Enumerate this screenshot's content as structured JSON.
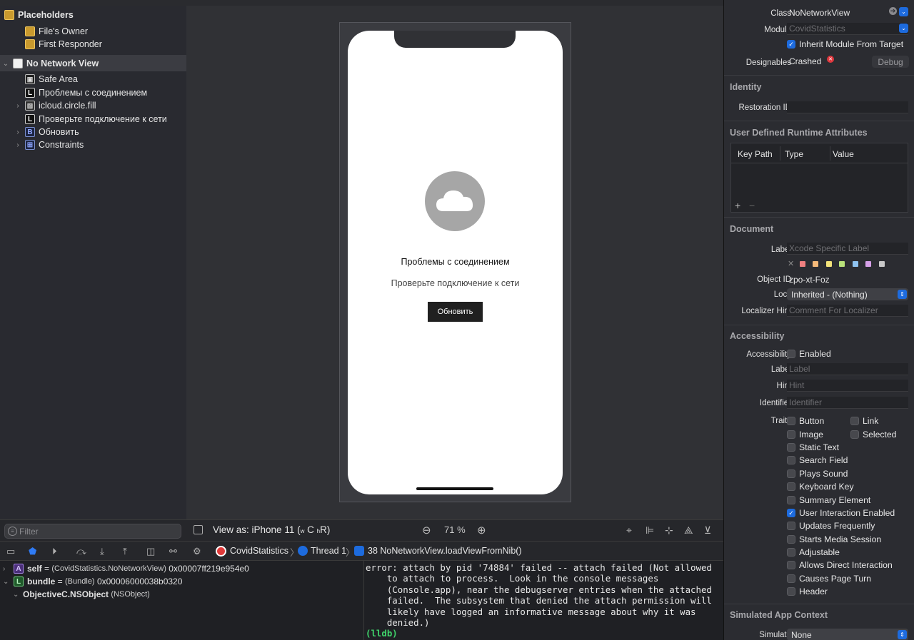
{
  "outline": {
    "items": [
      {
        "label": "Placeholders",
        "bold": true
      },
      {
        "label": "File's Owner"
      },
      {
        "label": "First Responder"
      },
      {
        "label": "No Network View",
        "bold": true
      },
      {
        "label": "Safe Area"
      },
      {
        "label": "Проблемы с соединением"
      },
      {
        "label": "icloud.circle.fill"
      },
      {
        "label": "Проверьте подключение к сети"
      },
      {
        "label": "Обновить"
      },
      {
        "label": "Constraints"
      }
    ],
    "filter_placeholder": "Filter"
  },
  "canvas": {
    "title": "Проблемы с соединением",
    "subtitle": "Проверьте подключение к сети",
    "button": "Обновить",
    "view_as": "View as: iPhone 11 (",
    "view_as_w": "w",
    "view_as_c": "C",
    "view_as_h": "h",
    "view_as_r": "R)",
    "zoom": "71 %"
  },
  "debug": {
    "target": "CovidStatistics",
    "thread": "Thread 1",
    "frame": "38 NoNetworkView.loadViewFromNib()"
  },
  "vars": [
    {
      "badge": "A",
      "name": "self",
      "type": "(CovidStatistics.NoNetworkView)",
      "value": "0x00007ff219e954e0"
    },
    {
      "badge": "L",
      "name": "bundle",
      "type": "(Bundle)",
      "value": "0x00006000038b0320"
    },
    {
      "name": "ObjectiveC.NSObject",
      "type": "(NSObject)"
    }
  ],
  "console": {
    "lines": [
      "error: attach by pid '74884' failed -- attach failed (Not allowed",
      "    to attach to process.  Look in the console messages",
      "    (Console.app), near the debugserver entries when the attached",
      "    failed.  The subsystem that denied the attach permission will",
      "    likely have logged an informative message about why it was",
      "    denied.)"
    ],
    "prompt": "(lldb)"
  },
  "inspector": {
    "class_label": "Class",
    "class_value": "NoNetworkView",
    "module_label": "Module",
    "module_value": "CovidStatistics",
    "inherit": "Inherit Module From Target",
    "designables_label": "Designables",
    "designables_value": "Crashed",
    "debug_btn": "Debug",
    "identity": "Identity",
    "restoration_label": "Restoration ID",
    "udra": "User Defined Runtime Attributes",
    "col_key": "Key Path",
    "col_type": "Type",
    "col_value": "Value",
    "document": "Document",
    "doc_label": "Label",
    "doc_label_ph": "Xcode Specific Label",
    "object_id_label": "Object ID",
    "object_id": "zpo-xt-Foz",
    "lock_label": "Lock",
    "lock_value": "Inherited - (Nothing)",
    "loc_hint_label": "Localizer Hint",
    "loc_hint_ph": "Comment For Localizer",
    "accessibility": "Accessibility",
    "acc_label": "Accessibility",
    "acc_enabled": "Enabled",
    "label_label": "Label",
    "label_ph": "Label",
    "hint_label": "Hint",
    "hint_ph": "Hint",
    "ident_label": "Identifier",
    "ident_ph": "Identifier",
    "traits_label": "Traits",
    "traits": [
      {
        "label": "Button",
        "on": false
      },
      {
        "label": "Link",
        "on": false
      },
      {
        "label": "Image",
        "on": false
      },
      {
        "label": "Selected",
        "on": false
      },
      {
        "label": "Static Text",
        "on": false
      },
      {
        "label": "Search Field",
        "on": false
      },
      {
        "label": "Plays Sound",
        "on": false
      },
      {
        "label": "Keyboard Key",
        "on": false
      },
      {
        "label": "Summary Element",
        "on": false
      },
      {
        "label": "User Interaction Enabled",
        "on": true
      },
      {
        "label": "Updates Frequently",
        "on": false
      },
      {
        "label": "Starts Media Session",
        "on": false
      },
      {
        "label": "Adjustable",
        "on": false
      },
      {
        "label": "Allows Direct Interaction",
        "on": false
      },
      {
        "label": "Causes Page Turn",
        "on": false
      },
      {
        "label": "Header",
        "on": false
      }
    ],
    "sim_section": "Simulated App Context",
    "simulate_label": "Simulate",
    "simulate_value": "None",
    "swatches": [
      "#f08080",
      "#f5b97a",
      "#f2e27a",
      "#b9e27a",
      "#8fc3f0",
      "#d6a0e8",
      "#c8c8c8"
    ]
  }
}
